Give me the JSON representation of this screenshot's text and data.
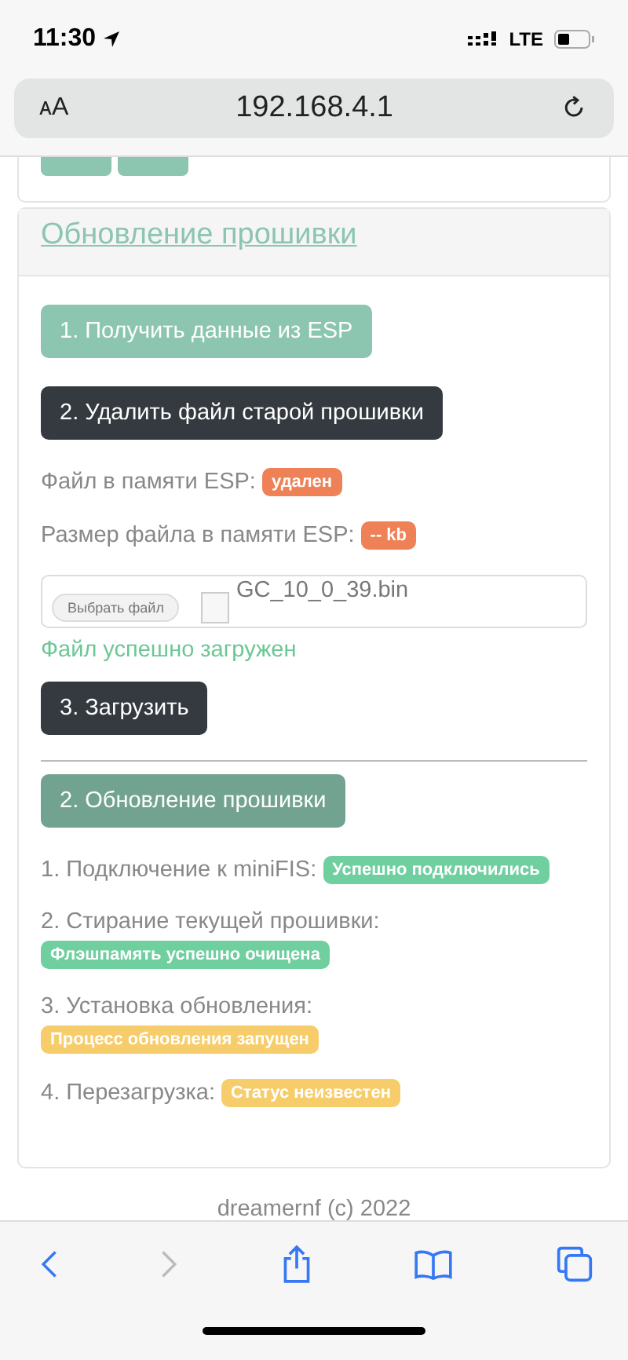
{
  "status_bar": {
    "time": "11:30",
    "network": "LTE"
  },
  "address_bar": {
    "text_size": "ᴀA",
    "url": "192.168.4.1"
  },
  "previous_card": {
    "buttons": [
      {
        "kind": "partial"
      },
      {
        "kind": "partial"
      }
    ]
  },
  "card": {
    "title": "Обновление прошивки",
    "items": [
      {
        "kind": "button",
        "color": "#8cc5b0",
        "label": "1. Получить данные из ESP"
      },
      {
        "kind": "button",
        "color": "#343a40",
        "label": "2. Удалить файл старой прошивки"
      },
      {
        "kind": "status",
        "label": "Файл в памяти ESP:",
        "badge": "удален",
        "color": "#ef8157"
      },
      {
        "kind": "status",
        "label": "Размер файла в памяти ESP:",
        "badge": "-- kb",
        "color": "#ef8157"
      },
      {
        "kind": "file",
        "button": "Выбрать файл",
        "file_name": "GC_10_0_39.bin"
      },
      {
        "kind": "message",
        "text": "Файл успешно загружен"
      },
      {
        "kind": "button",
        "color": "#343a40",
        "label": "3. Загрузить"
      },
      {
        "kind": "divider"
      },
      {
        "kind": "button",
        "color": "#72a390",
        "label": "2. Обновление прошивки"
      },
      {
        "kind": "status",
        "label": "1. Подключение к miniFIS:",
        "badge": "Успешно подключились",
        "color": "#6fcf9f"
      },
      {
        "kind": "status",
        "label": "2. Стирание текущей прошивки:",
        "badge": "Флэшпамять успешно очищена",
        "color": "#6fcf9f"
      },
      {
        "kind": "status",
        "label": "3. Установка обновления:",
        "badge": "Процесс обновления запущен",
        "color": "#f7cd6b"
      },
      {
        "kind": "status",
        "label": "4. Перезагрузка:",
        "badge": "Статус неизвестен",
        "color": "#f7cd6b"
      }
    ]
  },
  "footer": "dreamernf (c) 2022"
}
